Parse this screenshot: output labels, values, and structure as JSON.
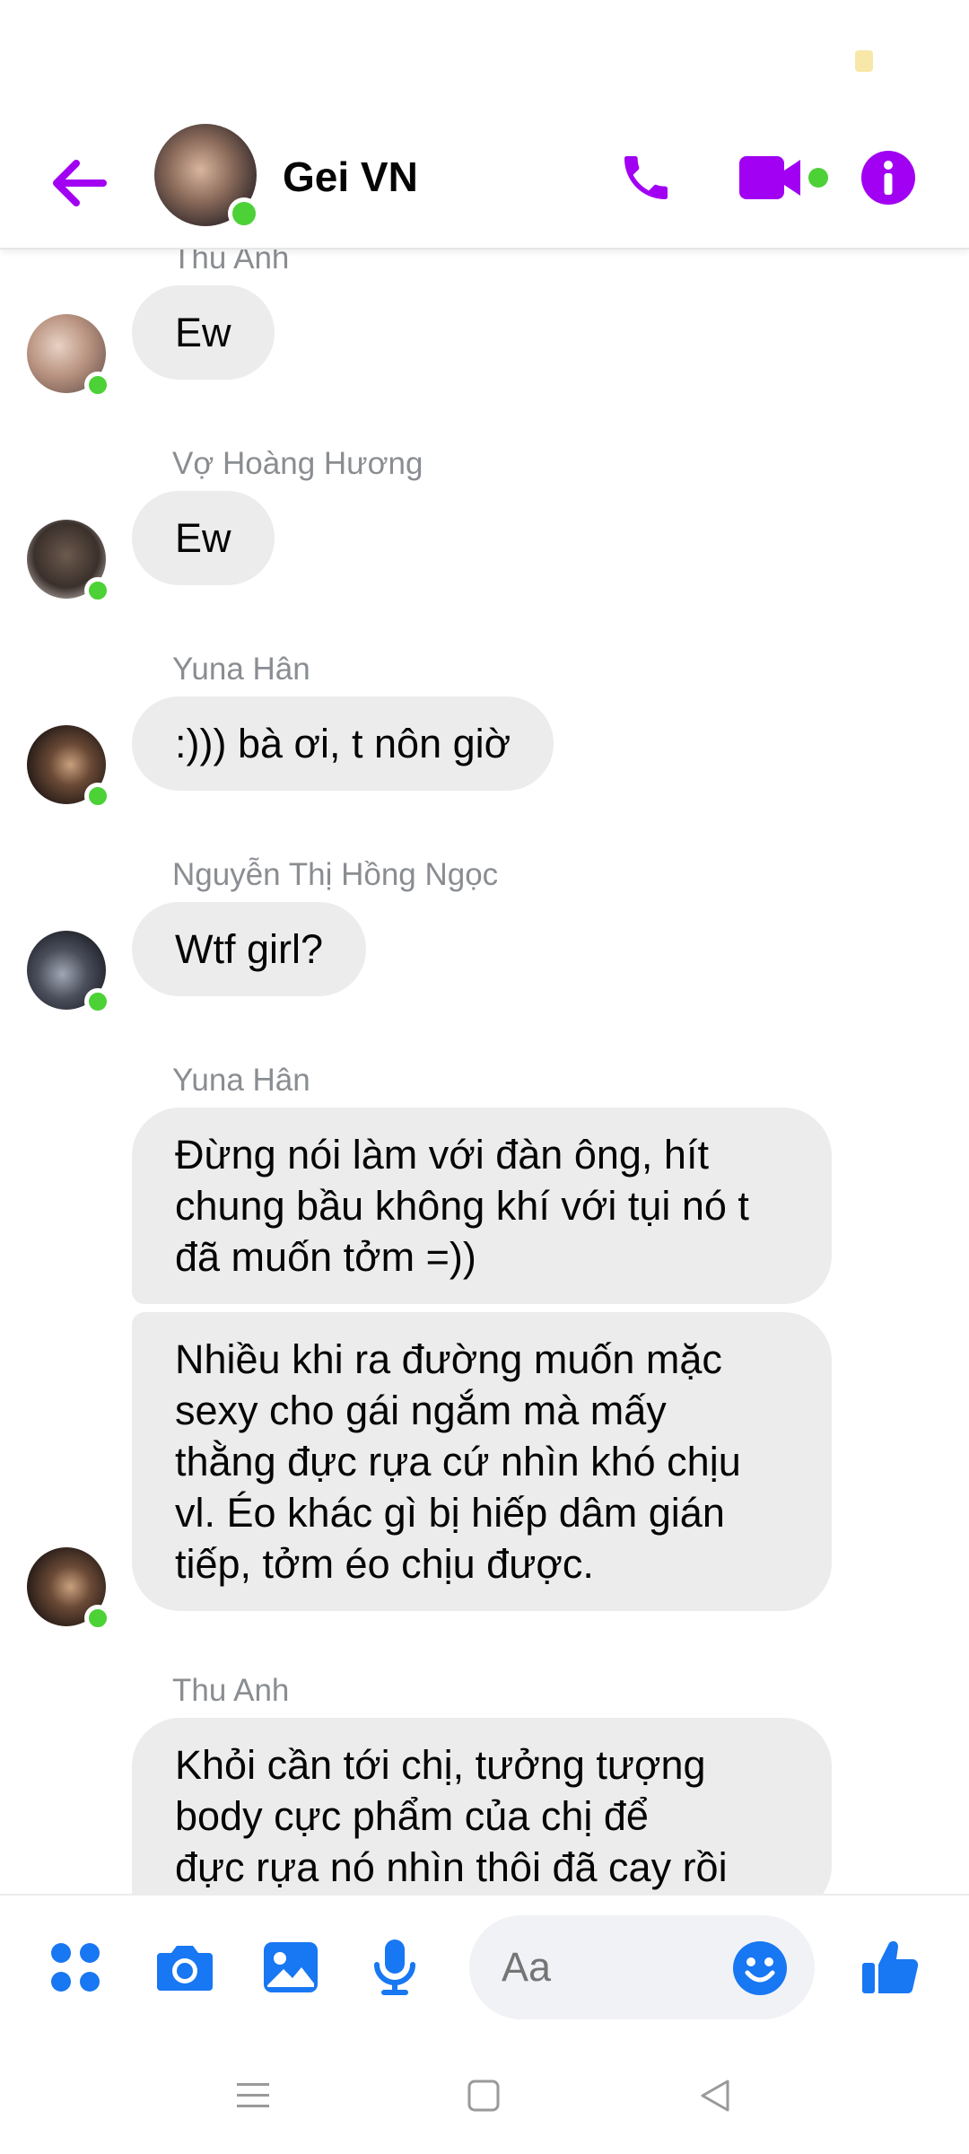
{
  "header": {
    "group_name": "Gei VN",
    "accent_color": "#a100f2"
  },
  "messages": [
    {
      "sender": "Thu Anh",
      "bubbles": [
        "Ew"
      ]
    },
    {
      "sender": "Vợ Hoàng Hương",
      "bubbles": [
        "Ew"
      ]
    },
    {
      "sender": "Yuna Hân",
      "bubbles": [
        ":))) bà ơi, t nôn giờ"
      ]
    },
    {
      "sender": "Nguyễn Thị Hồng Ngọc",
      "bubbles": [
        "Wtf girl?"
      ]
    },
    {
      "sender": "Yuna Hân",
      "bubbles": [
        "Đừng nói làm với đàn ông, hít\nchung bầu không khí với tụi nó t\nđã muốn tởm =))",
        "Nhiều khi ra đường muốn mặc\nsexy cho gái ngắm mà mấy\nthằng đực rựa cứ nhìn khó chịu\nvl. Éo khác gì bị hiếp dâm gián\ntiếp, tởm éo chịu được."
      ]
    },
    {
      "sender": "Thu Anh",
      "bubbles": [
        "Khỏi cần tới chị, tưởng tượng\nbody cực phẩm của chị để\nđực rựa nó nhìn thôi đã cay rồi"
      ]
    }
  ],
  "composer": {
    "placeholder": "Aa",
    "accent_color": "#1877f2",
    "icons": [
      "menu-dots-icon",
      "camera-icon",
      "image-icon",
      "microphone-icon",
      "emoji-icon",
      "thumbs-up-icon"
    ]
  },
  "navbar": {
    "icons": [
      "recent-apps-icon",
      "home-icon",
      "back-icon"
    ]
  }
}
